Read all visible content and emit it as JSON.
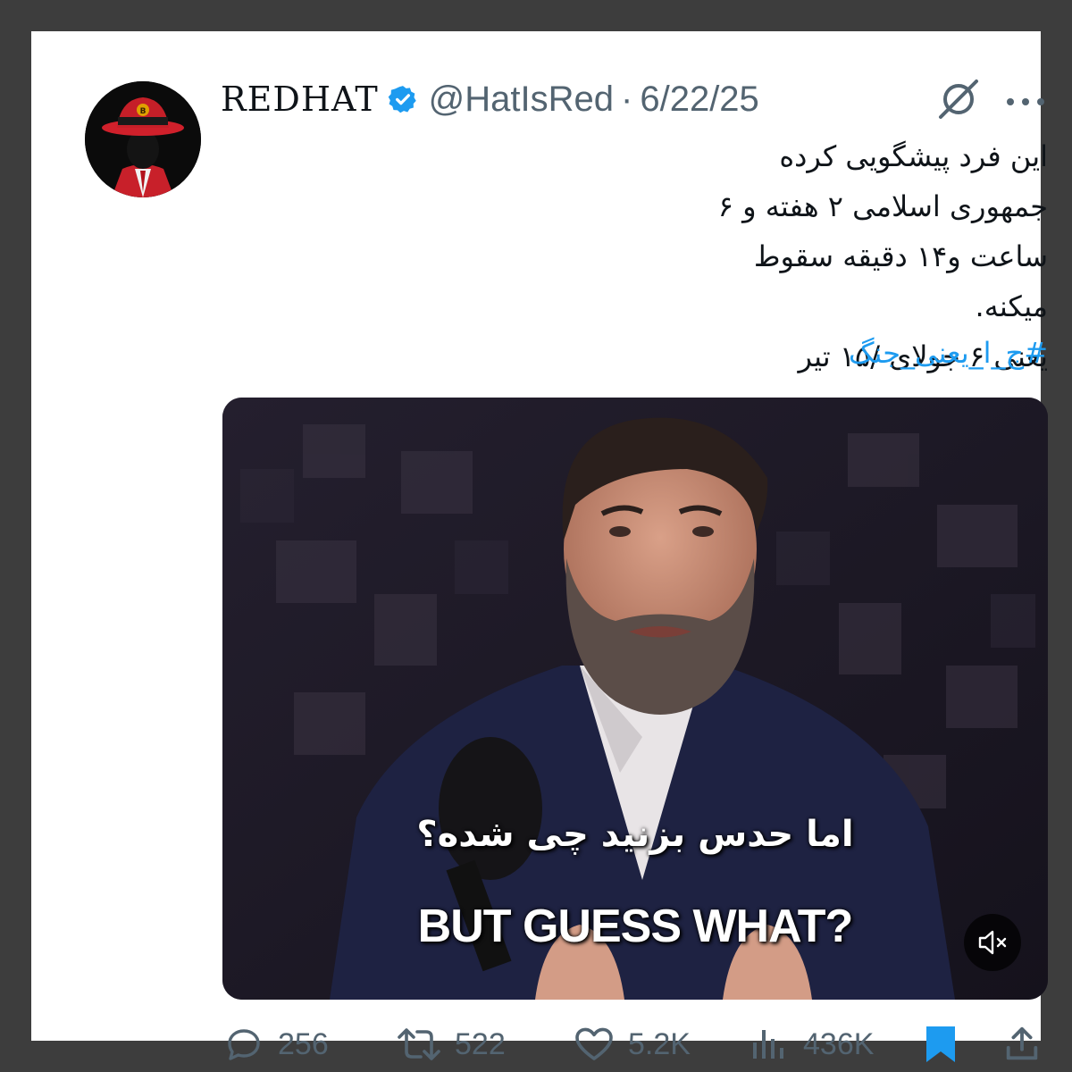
{
  "tweet": {
    "display_name": "REDHAT",
    "handle": "@HatIsRed",
    "separator": "·",
    "date": "6/22/25",
    "text_lines": [
      "این فرد پیشگویی کرده جمهوری اسلامی ۲ هفته و ۶",
      "ساعت و۱۴ دقیقه سقوط میکنه.",
      "یعنی ۶ جولای /۱۵ تیر"
    ],
    "hashtag": "#ج_ا_یعنی_جنگ"
  },
  "media": {
    "subtitle_fa": "اما حدس بزنید چی شده؟",
    "subtitle_en": "BUT GUESS WHAT?",
    "mute_icon": "volume-muted-icon"
  },
  "actions": {
    "replies": "256",
    "retweets": "522",
    "likes": "5.2K",
    "views": "436K"
  },
  "colors": {
    "accent": "#1d9bf0",
    "muted_text": "#536471",
    "text": "#0f1419",
    "frame": "#3d3d3d"
  },
  "icons": {
    "reply": "reply-icon",
    "retweet": "retweet-icon",
    "like": "heart-icon",
    "views": "views-icon",
    "bookmark": "bookmark-icon",
    "share": "share-icon",
    "grok": "grok-icon",
    "more": "more-icon",
    "verified": "verified-badge-icon"
  }
}
